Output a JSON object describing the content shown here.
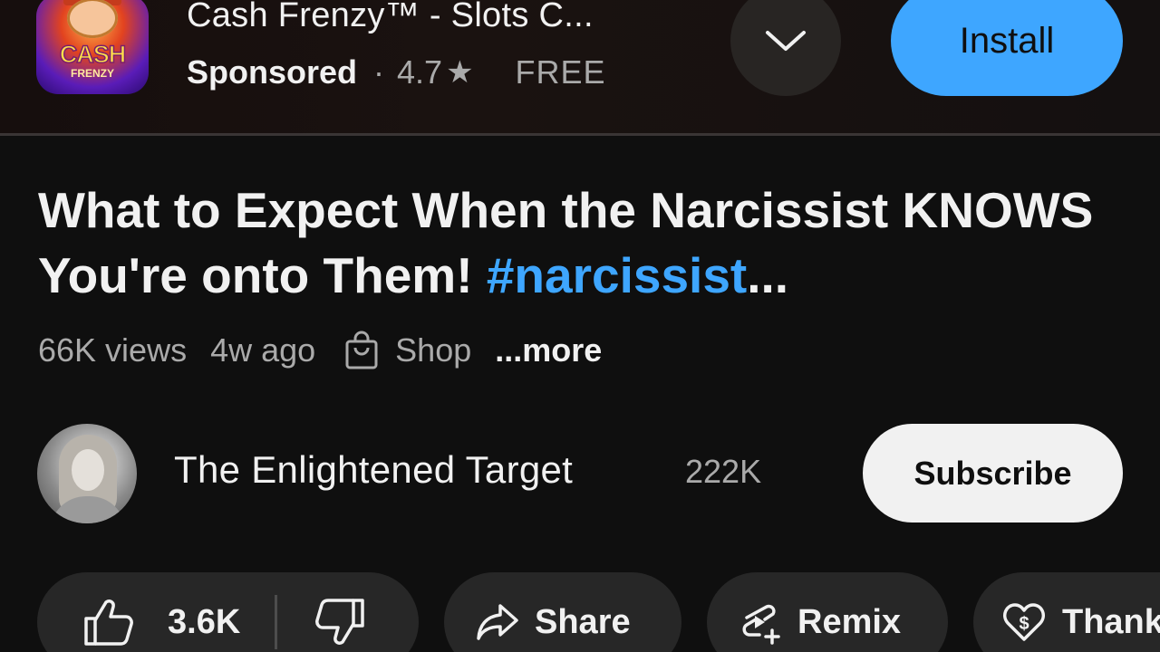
{
  "ad": {
    "app_name": "Cash Frenzy™ - Slots C...",
    "icon_text": "CASH",
    "icon_subtext": "FRENZY",
    "sponsored_label": "Sponsored",
    "separator": "·",
    "rating": "4.7",
    "rating_icon": "★",
    "price": "FREE",
    "install_label": "Install",
    "accent_color": "#3ea6ff"
  },
  "video": {
    "title_part1": "What to Expect When the Narcissist KNOWS You're onto Them! ",
    "hashtag": "#narcissist",
    "title_ellipsis": "...",
    "views": "66K views",
    "age": "4w ago",
    "shop_label": "Shop",
    "more_label": "...more"
  },
  "channel": {
    "name": "The Enlightened Target",
    "subscribers": "222K",
    "subscribe_label": "Subscribe"
  },
  "actions": {
    "like_count": "3.6K",
    "share_label": "Share",
    "remix_label": "Remix",
    "thanks_label": "Thanks"
  },
  "icons": [
    "chevron-down-icon",
    "star-icon",
    "shopping-bag-icon",
    "thumbs-up-icon",
    "thumbs-down-icon",
    "share-arrow-icon",
    "remix-icon",
    "heart-dollar-icon"
  ]
}
